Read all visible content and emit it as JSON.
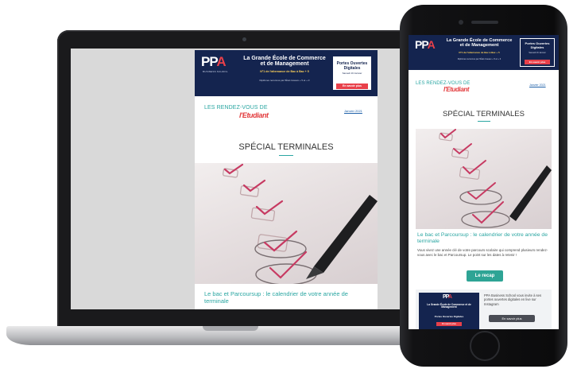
{
  "banner": {
    "logo_main": "PP",
    "logo_accent": "A",
    "logo_sub": "BUSINESS SCHOOL",
    "title_line1": "La Grande École de Commerce",
    "title_line2": "et de Management",
    "tagline": "N°1 de l'alternance de Bac à Bac + 5",
    "tagline_small": "Diplômes reconnus par l'État niveaux + 5 et + 3",
    "po_title": "Portes Ouvertes Digitales",
    "po_date": "Samedi 16 Janvier",
    "po_button": "En savoir plus"
  },
  "newsletter": {
    "rdv_title": "LES RENDEZ-VOUS DE",
    "etu_logo": "l'Etudiant",
    "date_link": "Janvier 2021",
    "special_title": "SPÉCIAL TERMINALES"
  },
  "article": {
    "title": "Le bac et Parcoursup : le calendrier de votre année de terminale",
    "body": "Vous vivez une année clé de votre parcours scolaire qui comprend plusieurs rendez-vous avec le bac et Parcoursup. Le point sur les dates à retenir !",
    "button": "Le recap"
  },
  "promo": {
    "text": "PPA Business School vous invite à ses portes ouvertes digitales en live sur Instagram",
    "button": "En savoir plus",
    "mini_title": "La Grande École de Commerce et de Management",
    "mini_po": "Portes Ouvertes Digitales"
  },
  "colors": {
    "navy": "#14244f",
    "teal": "#2aa6a2",
    "red": "#e8404a",
    "recap_green": "#2ea495"
  }
}
